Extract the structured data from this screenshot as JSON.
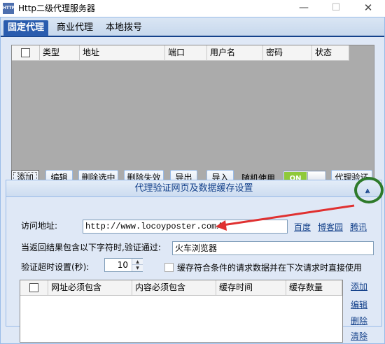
{
  "window": {
    "title": "Http二级代理服务器",
    "icon_text": "HTTP",
    "min_icon": "minimize-icon",
    "max_icon": "maximize-icon",
    "close_icon": "close-icon"
  },
  "tabs": [
    "固定代理",
    "商业代理",
    "本地拨号"
  ],
  "proxy_grid": {
    "columns": [
      "类型",
      "地址",
      "端口",
      "用户名",
      "密码",
      "状态"
    ],
    "rows": []
  },
  "toolbar": {
    "add": "添加",
    "edit": "编辑",
    "delete_selected": "删除选中",
    "delete_failed": "删除失效",
    "export": "导出",
    "import": "导入",
    "random_label": "随机使用",
    "toggle_text": "ON",
    "verify": "代理验证"
  },
  "panel": {
    "title": "代理验证网页及数据缓存设置",
    "collapse_icon": "double-chevron-up-icon",
    "url_label": "访问地址:",
    "url_value": "http://www.locoyposter.com/",
    "quick_links": [
      "百度",
      "博客园",
      "腾讯"
    ],
    "pass_label": "当返回结果包含以下字符时,验证通过:",
    "pass_value": "火车浏览器",
    "timeout_label": "验证超时设置(秒):",
    "timeout_value": "10",
    "cache_checkbox_label": "缓存符合条件的请求数据并在下次请求时直接使用",
    "cache_grid": {
      "columns": [
        "网址必须包含",
        "内容必须包含",
        "缓存时间",
        "缓存数量"
      ],
      "rows": []
    },
    "side_links": [
      "添加",
      "编辑",
      "删除",
      "清除"
    ]
  },
  "colors": {
    "accent": "#2a5cae",
    "panel_bg": "#dfe8f6",
    "annotation_red": "#e03030",
    "annotation_green": "#2e7a2b"
  }
}
